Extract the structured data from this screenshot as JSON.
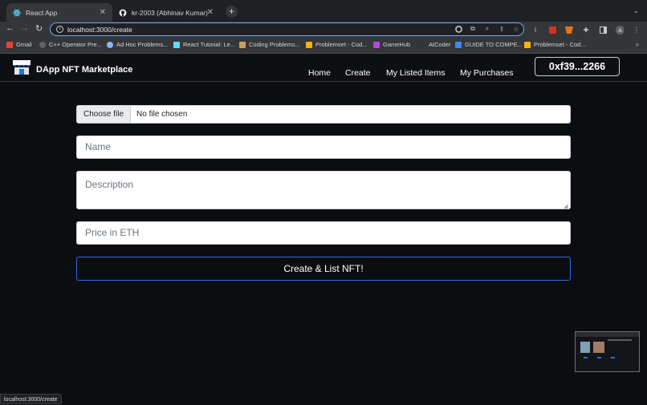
{
  "browser": {
    "tabs": [
      {
        "label": "React App",
        "icon": "react-icon",
        "active": true
      },
      {
        "label": "kr-2003 (Abhinav Kumar)",
        "icon": "github-icon",
        "active": false
      }
    ],
    "new_tab": "+",
    "url": "localhost:3000/create",
    "bookmarks": [
      {
        "label": "Gmail",
        "color": "#ea4335"
      },
      {
        "label": "C++ Operator Pre...",
        "color": "#5f6368"
      },
      {
        "label": "Ad Hoc Problems...",
        "color": "#8ab4f8"
      },
      {
        "label": "React Tutorial: Le...",
        "color": "#61dafb"
      },
      {
        "label": "Coding Problems...",
        "color": "#c8a25a"
      },
      {
        "label": "Problemset - Cod...",
        "color": "#f4b400"
      },
      {
        "label": "GameHub",
        "color": "#b04ad8"
      },
      {
        "label": "AtCoder",
        "color": "#35363a"
      },
      {
        "label": "GUIDE TO COMPE...",
        "color": "#4285f4"
      },
      {
        "label": "Problemset - Cod...",
        "color": "#f4b400"
      }
    ],
    "status_url": "localhost:3000/create"
  },
  "navbar": {
    "brand": "DApp NFT Marketplace",
    "links": [
      "Home",
      "Create",
      "My Listed Items",
      "My Purchases"
    ],
    "wallet": "0xf39...2266"
  },
  "form": {
    "file_button": "Choose file",
    "file_status": "No file chosen",
    "name_placeholder": "Name",
    "description_placeholder": "Description",
    "price_placeholder": "Price in ETH",
    "submit_label": "Create & List NFT!"
  },
  "colors": {
    "page_bg": "#0c0d10",
    "accent_border": "#2c6ae0"
  }
}
